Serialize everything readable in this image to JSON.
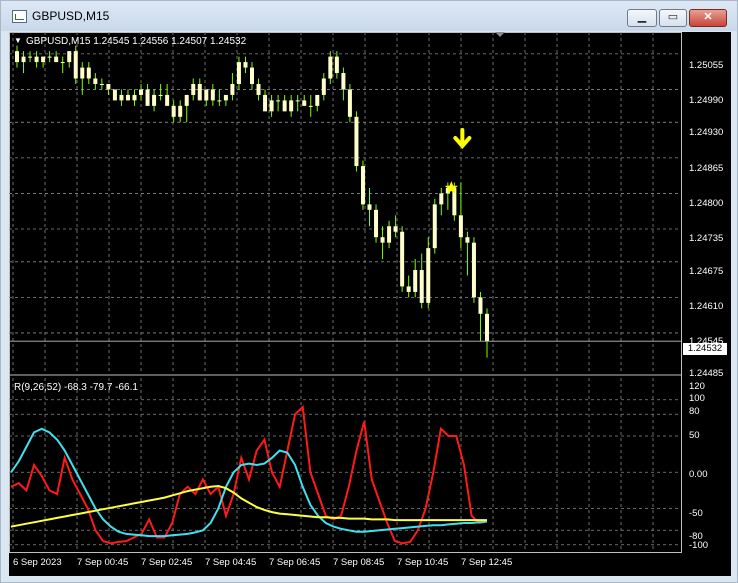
{
  "window": {
    "title": "GBPUSD,M15",
    "min_glyph": "▁",
    "max_glyph": "▭",
    "close_glyph": "✕"
  },
  "chart": {
    "header": "GBPUSD,M15  1.24545 1.24556 1.24507 1.24532",
    "collapse_glyph": "▼",
    "current_price": "1.24532",
    "price_ticks": [
      "1.25055",
      "1.24990",
      "1.24930",
      "1.24865",
      "1.24800",
      "1.24735",
      "1.24675",
      "1.24610",
      "1.24545",
      "1.24485"
    ],
    "indicator_header": "R(9,26,52) -68.3 -79.7 -66.1",
    "indicator_ticks": [
      "120",
      "100",
      "80",
      "50",
      "0.00",
      "-50",
      "-80",
      "-100"
    ],
    "time_labels": [
      "6 Sep 2023",
      "7 Sep 00:45",
      "7 Sep 02:45",
      "7 Sep 04:45",
      "7 Sep 06:45",
      "7 Sep 08:45",
      "7 Sep 10:45",
      "7 Sep 12:45"
    ],
    "signal_arrow": "down-arrow-icon",
    "signal_star": "star-icon",
    "colors": {
      "background": "#000000",
      "candle": "#ffffcc",
      "wick": "#7fff00",
      "red": "#ff1a1a",
      "cyan": "#40e0f0",
      "yellow": "#ffff40",
      "arrow": "#ffff00"
    }
  },
  "chart_data": {
    "type": "candlestick",
    "candles": [
      [
        1.2506,
        1.2507,
        1.2503,
        1.2504
      ],
      [
        1.2504,
        1.2506,
        1.2502,
        1.2505
      ],
      [
        1.2505,
        1.2506,
        1.2504,
        1.2505
      ],
      [
        1.2505,
        1.2506,
        1.2503,
        1.2504
      ],
      [
        1.2504,
        1.2505,
        1.2503,
        1.2505
      ],
      [
        1.2505,
        1.2506,
        1.2504,
        1.2505
      ],
      [
        1.2505,
        1.2506,
        1.2504,
        1.2504
      ],
      [
        1.2504,
        1.2505,
        1.2502,
        1.2504
      ],
      [
        1.2504,
        1.2506,
        1.2503,
        1.2506
      ],
      [
        1.2506,
        1.2507,
        1.25,
        1.2501
      ],
      [
        1.2501,
        1.2504,
        1.2498,
        1.2503
      ],
      [
        1.2503,
        1.2504,
        1.25,
        1.2501
      ],
      [
        1.2501,
        1.2502,
        1.2499,
        1.25
      ],
      [
        1.25,
        1.2501,
        1.2499,
        1.25
      ],
      [
        1.25,
        1.25,
        1.2498,
        1.2499
      ],
      [
        1.2499,
        1.2499,
        1.2497,
        1.2497
      ],
      [
        1.2497,
        1.2499,
        1.2496,
        1.2498
      ],
      [
        1.2498,
        1.2499,
        1.2497,
        1.2497
      ],
      [
        1.2497,
        1.2499,
        1.2496,
        1.2498
      ],
      [
        1.2498,
        1.25,
        1.2497,
        1.2499
      ],
      [
        1.2499,
        1.25,
        1.2496,
        1.2496
      ],
      [
        1.2496,
        1.2499,
        1.2495,
        1.2498
      ],
      [
        1.2498,
        1.25,
        1.2497,
        1.2498
      ],
      [
        1.2498,
        1.25,
        1.2497,
        1.2496
      ],
      [
        1.2496,
        1.2497,
        1.2493,
        1.2494
      ],
      [
        1.2494,
        1.2497,
        1.2493,
        1.2496
      ],
      [
        1.2496,
        1.2498,
        1.2493,
        1.2498
      ],
      [
        1.2498,
        1.2501,
        1.2497,
        1.25
      ],
      [
        1.25,
        1.2501,
        1.2497,
        1.2497
      ],
      [
        1.2497,
        1.2499,
        1.2496,
        1.2499
      ],
      [
        1.2499,
        1.25,
        1.2496,
        1.2497
      ],
      [
        1.2497,
        1.2499,
        1.2496,
        1.2497
      ],
      [
        1.2497,
        1.2498,
        1.2496,
        1.2498
      ],
      [
        1.2498,
        1.2502,
        1.2497,
        1.25
      ],
      [
        1.25,
        1.2505,
        1.2499,
        1.2504
      ],
      [
        1.2504,
        1.2505,
        1.2502,
        1.2503
      ],
      [
        1.2503,
        1.2504,
        1.2499,
        1.25
      ],
      [
        1.25,
        1.2501,
        1.2497,
        1.2498
      ],
      [
        1.2498,
        1.2499,
        1.2495,
        1.2495
      ],
      [
        1.2495,
        1.2498,
        1.2494,
        1.2497
      ],
      [
        1.2497,
        1.2498,
        1.2495,
        1.2497
      ],
      [
        1.2497,
        1.2498,
        1.2495,
        1.2495
      ],
      [
        1.2495,
        1.2498,
        1.2494,
        1.2497
      ],
      [
        1.2497,
        1.2498,
        1.2495,
        1.2497
      ],
      [
        1.2497,
        1.2498,
        1.2496,
        1.2496
      ],
      [
        1.2496,
        1.2498,
        1.2494,
        1.2496
      ],
      [
        1.2496,
        1.2498,
        1.2495,
        1.2498
      ],
      [
        1.2498,
        1.2502,
        1.2497,
        1.2501
      ],
      [
        1.2501,
        1.2506,
        1.25,
        1.2505
      ],
      [
        1.2505,
        1.2506,
        1.2501,
        1.2502
      ],
      [
        1.2502,
        1.2503,
        1.2497,
        1.2499
      ],
      [
        1.2499,
        1.25,
        1.2493,
        1.2494
      ],
      [
        1.2494,
        1.2495,
        1.2484,
        1.2485
      ],
      [
        1.2485,
        1.2486,
        1.2477,
        1.2478
      ],
      [
        1.2478,
        1.2481,
        1.2474,
        1.2477
      ],
      [
        1.2477,
        1.2478,
        1.2471,
        1.2472
      ],
      [
        1.2472,
        1.2474,
        1.2468,
        1.2471
      ],
      [
        1.2471,
        1.2475,
        1.247,
        1.2474
      ],
      [
        1.2474,
        1.2476,
        1.2472,
        1.2473
      ],
      [
        1.2473,
        1.2474,
        1.2462,
        1.2463
      ],
      [
        1.2463,
        1.2465,
        1.2461,
        1.2462
      ],
      [
        1.2462,
        1.2468,
        1.2461,
        1.2466
      ],
      [
        1.2466,
        1.2469,
        1.2459,
        1.246
      ],
      [
        1.246,
        1.2472,
        1.2459,
        1.247
      ],
      [
        1.247,
        1.2479,
        1.2469,
        1.2478
      ],
      [
        1.2478,
        1.2481,
        1.2476,
        1.248
      ],
      [
        1.248,
        1.2482,
        1.2477,
        1.2481
      ],
      [
        1.2481,
        1.2482,
        1.2475,
        1.2476
      ],
      [
        1.2476,
        1.2482,
        1.247,
        1.2472
      ],
      [
        1.2472,
        1.2473,
        1.2465,
        1.2471
      ],
      [
        1.2471,
        1.2472,
        1.246,
        1.2461
      ],
      [
        1.2461,
        1.2462,
        1.2453,
        1.2458
      ],
      [
        1.2458,
        1.2459,
        1.245,
        1.2453
      ]
    ],
    "ylim": [
      1.2447,
      1.25095
    ],
    "signal_index": 67,
    "oscillator": {
      "ylim": [
        -110,
        130
      ],
      "levels": [
        100,
        80,
        50,
        0,
        -50,
        -80,
        -100
      ],
      "series": [
        {
          "color": "#ff1a1a",
          "values": [
            -20,
            -15,
            -25,
            10,
            -5,
            -25,
            -30,
            20,
            -10,
            -30,
            -50,
            -80,
            -95,
            -98,
            -96,
            -95,
            -90,
            -85,
            -65,
            -90,
            -90,
            -70,
            -30,
            -20,
            -30,
            -10,
            -30,
            -20,
            -60,
            -30,
            20,
            -10,
            30,
            45,
            0,
            -20,
            30,
            80,
            90,
            0,
            -30,
            -60,
            -65,
            -60,
            -20,
            30,
            70,
            -10,
            -40,
            -70,
            -95,
            -98,
            -96,
            -80,
            -50,
            0,
            60,
            50,
            50,
            10,
            -60,
            -70,
            -68
          ]
        },
        {
          "color": "#40e0f0",
          "values": [
            0,
            15,
            35,
            55,
            60,
            55,
            45,
            30,
            10,
            -10,
            -30,
            -50,
            -65,
            -75,
            -82,
            -85,
            -86,
            -87,
            -88,
            -88,
            -88,
            -87,
            -86,
            -85,
            -83,
            -80,
            -70,
            -50,
            -20,
            0,
            10,
            12,
            10,
            12,
            20,
            30,
            27,
            10,
            -20,
            -45,
            -60,
            -70,
            -75,
            -78,
            -80,
            -82,
            -82,
            -81,
            -80,
            -79,
            -78,
            -77,
            -76,
            -75,
            -74,
            -73,
            -73,
            -72,
            -71,
            -70,
            -70,
            -69,
            -68
          ]
        },
        {
          "color": "#ffff40",
          "values": [
            -75,
            -73,
            -71,
            -69,
            -67,
            -65,
            -63,
            -61,
            -59,
            -57,
            -55,
            -53,
            -51,
            -49,
            -47,
            -45,
            -43,
            -41,
            -39,
            -37,
            -35,
            -32,
            -29,
            -26,
            -24,
            -22,
            -20,
            -19,
            -22,
            -28,
            -36,
            -42,
            -48,
            -52,
            -55,
            -57,
            -58,
            -59,
            -60,
            -61,
            -62,
            -62,
            -63,
            -63,
            -64,
            -64,
            -64,
            -65,
            -65,
            -65,
            -66,
            -66,
            -66,
            -66,
            -66,
            -66,
            -66,
            -66,
            -66,
            -66,
            -66,
            -66,
            -66
          ]
        }
      ]
    }
  }
}
